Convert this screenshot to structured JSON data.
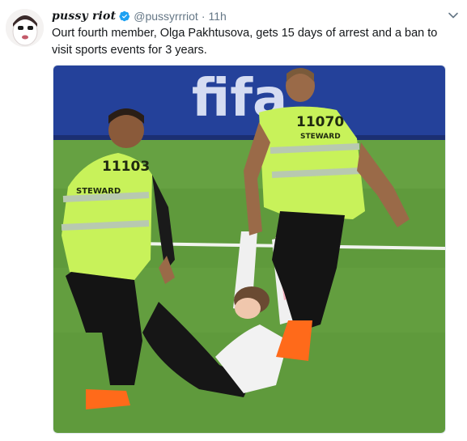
{
  "tweet": {
    "display_name": "pussy riot",
    "handle": "@pussyrrriot",
    "separator": "·",
    "time": "11h",
    "text": "Ourt fourth member, Olga Pakhtusova, gets 15 days of arrest and a ban to visit sports events for 3 years.",
    "verified": true
  },
  "media": {
    "vest_number_left": "11103",
    "vest_label_left": "STEWARD",
    "vest_number_right": "11070",
    "vest_label_right": "STEWARD",
    "board_text": "fifa",
    "colors": {
      "grass": "#5f9a3c",
      "vest": "#c8f25a",
      "board": "#24419a",
      "boot": "#ff6a1a"
    }
  },
  "icons": {
    "verified": "verified-badge-icon",
    "caret": "chevron-down-icon"
  }
}
